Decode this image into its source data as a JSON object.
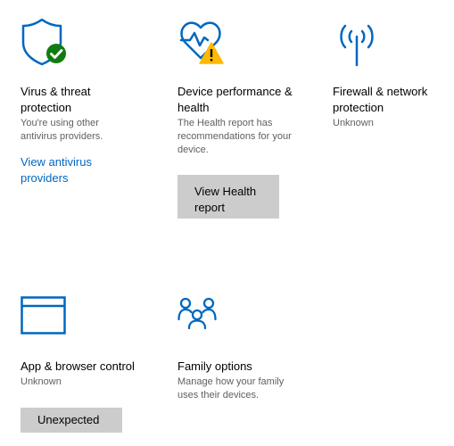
{
  "tiles": {
    "virus": {
      "title": "Virus & threat\nprotection",
      "description": "You're using other\nantivirus providers.",
      "link": "View antivirus\nproviders",
      "icon": "shield-check-icon",
      "status": "ok"
    },
    "device": {
      "title": "Device performance &\nhealth",
      "description": "The Health report has\nrecommendations for your\ndevice.",
      "button": "View Health\nreport",
      "icon": "heart-pulse-icon",
      "status": "warning"
    },
    "firewall": {
      "title": "Firewall & network\nprotection",
      "description": "Unknown",
      "icon": "antenna-icon"
    },
    "app": {
      "title": "App & browser control",
      "description": "Unknown",
      "button": "Unexpected",
      "icon": "browser-window-icon"
    },
    "family": {
      "title": "Family options",
      "description": "Manage how your family\nuses their devices.",
      "icon": "family-icon"
    }
  },
  "colors": {
    "accent": "#0067c0",
    "ok": "#107c10",
    "warning": "#ffb900",
    "button": "#cccccc",
    "secondary_text": "#5f5f5f"
  }
}
